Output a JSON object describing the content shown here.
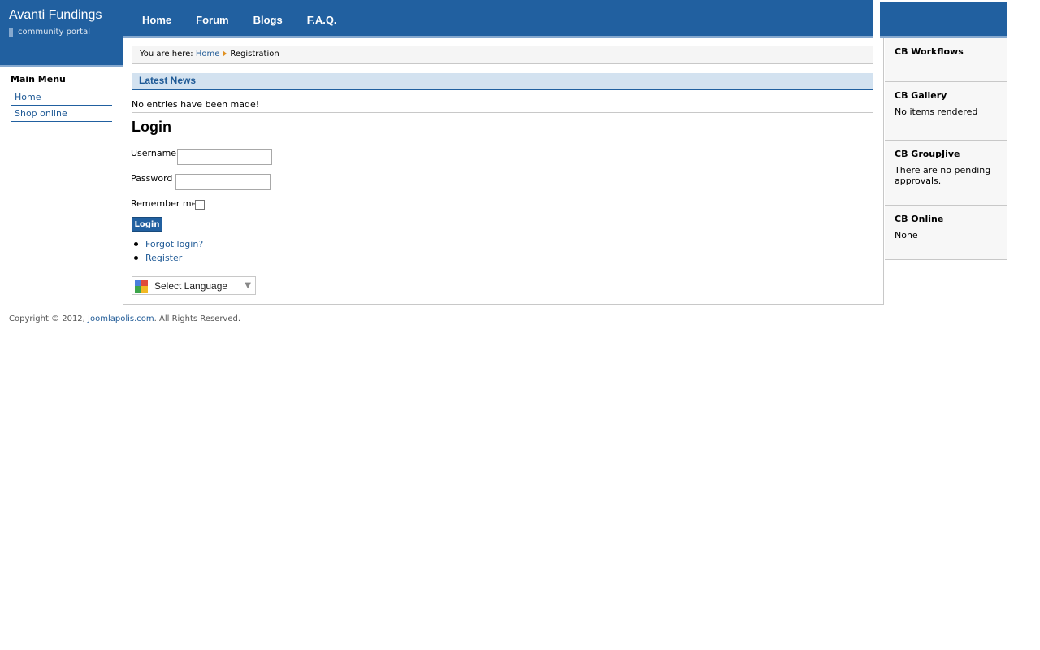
{
  "site": {
    "title": "Avanti Fundings",
    "tagline": "community portal"
  },
  "topnav": [
    {
      "label": "Home"
    },
    {
      "label": "Forum"
    },
    {
      "label": "Blogs"
    },
    {
      "label": "F.A.Q."
    }
  ],
  "main_menu": {
    "title": "Main Menu",
    "items": [
      {
        "label": "Home"
      },
      {
        "label": "Shop online"
      }
    ]
  },
  "breadcrumb": {
    "prefix": "You are here:",
    "home": "Home",
    "current": "Registration"
  },
  "latest_news": {
    "title": "Latest News",
    "body": "No entries have been made!"
  },
  "login": {
    "title": "Login",
    "username_label": "Username",
    "username_value": "",
    "password_label": "Password",
    "password_value": "",
    "remember_label": "Remember me",
    "remember_checked": false,
    "button_label": "Login",
    "forgot_link": "Forgot login?",
    "register_link": "Register"
  },
  "translate": {
    "label": "Select Language"
  },
  "right_modules": [
    {
      "title": "CB Workflows",
      "body": ""
    },
    {
      "title": "CB Gallery",
      "body": "No items rendered"
    },
    {
      "title": "CB GroupJive",
      "body": "There are no pending approvals."
    },
    {
      "title": "CB Online",
      "body": "None"
    }
  ],
  "footer": {
    "prefix": "Copyright © 2012,",
    "link": "Joomlapolis.com",
    "suffix": ". All Rights Reserved."
  },
  "colors": {
    "brand_blue": "#2160a0",
    "light_blue": "#d3e2f0",
    "link": "#1f5a96"
  }
}
